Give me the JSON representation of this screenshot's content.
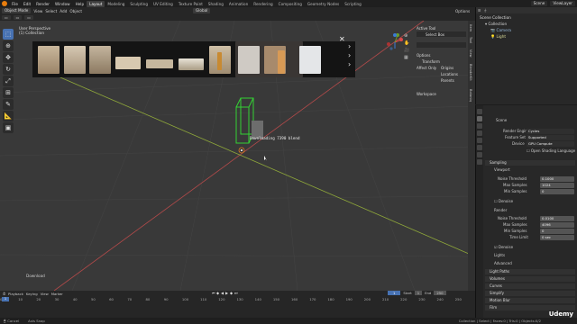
{
  "topbar": {
    "menus": [
      "File",
      "Edit",
      "Render",
      "Window",
      "Help"
    ],
    "workspaces": [
      "Layout",
      "Modeling",
      "Sculpting",
      "UV Editing",
      "Texture Paint",
      "Shading",
      "Animation",
      "Rendering",
      "Compositing",
      "Geometry Nodes",
      "Scripting"
    ],
    "scene": "Scene",
    "view_layer": "ViewLayer"
  },
  "header": {
    "mode": "Object Mode",
    "menus": [
      "View",
      "Select",
      "Add",
      "Object"
    ],
    "orientation": "Global",
    "options": "Options"
  },
  "viewport": {
    "title": "User Perspective",
    "collection": "(1) Collection",
    "downloading_text": "Downloading  7390 blend"
  },
  "npanel": {
    "active_tool_header": "Active Tool",
    "select_box": "Select Box",
    "options_header": "Options",
    "transform_header": "Transform",
    "affect_only": "Affect Only",
    "origins": "Origins",
    "locations": "Locations",
    "parents": "Parents",
    "workspace_header": "Workspace",
    "tabs": [
      "Item",
      "Tool",
      "View",
      "BlenderKit",
      "Botaniq"
    ]
  },
  "outliner": {
    "header": "Scene Collection",
    "items": [
      "Collection",
      "Camera",
      "Light"
    ]
  },
  "properties": {
    "header": "Scene",
    "render_engine_label": "Render Engine",
    "render_engine": "Cycles",
    "feature_set_label": "Feature Set",
    "feature_set": "Supported",
    "device_label": "Device",
    "device": "GPU Compute",
    "osl_label": "Open Shading Language",
    "sampling": "Sampling",
    "viewport_sub": "Viewport",
    "noise_threshold_label": "Noise Threshold",
    "viewport_noise": "0.1000",
    "max_samples_label": "Max Samples",
    "viewport_max": "1024",
    "min_samples_label": "Min Samples",
    "viewport_min": "0",
    "denoise_label": "Denoise",
    "render_sub": "Render",
    "render_noise": "0.0100",
    "render_max": "4096",
    "render_min": "0",
    "time_limit_label": "Time Limit",
    "time_limit": "0 sec",
    "denoise2_label": "Denoise",
    "lights": "Lights",
    "advanced": "Advanced",
    "sections": [
      "Light Paths",
      "Volumes",
      "Curves",
      "Simplify",
      "Motion Blur",
      "Film"
    ]
  },
  "timeline": {
    "menus": [
      "Playback",
      "Keying",
      "View",
      "Marker"
    ],
    "current_frame": "1",
    "start_label": "Start",
    "start": "1",
    "end_label": "End",
    "end": "250",
    "ruler": [
      "0",
      "10",
      "20",
      "30",
      "40",
      "50",
      "60",
      "70",
      "80",
      "90",
      "100",
      "110",
      "120",
      "130",
      "140",
      "150",
      "160",
      "170",
      "180",
      "190",
      "200",
      "210",
      "220",
      "230",
      "240",
      "250"
    ]
  },
  "bottom_left": "Download",
  "status": {
    "left": "Cancel",
    "mid": "Axis Snap",
    "right": "Collection | Select | Faces:0 | Tris:0 | Objects:0/2"
  },
  "watermark": "Udemy"
}
